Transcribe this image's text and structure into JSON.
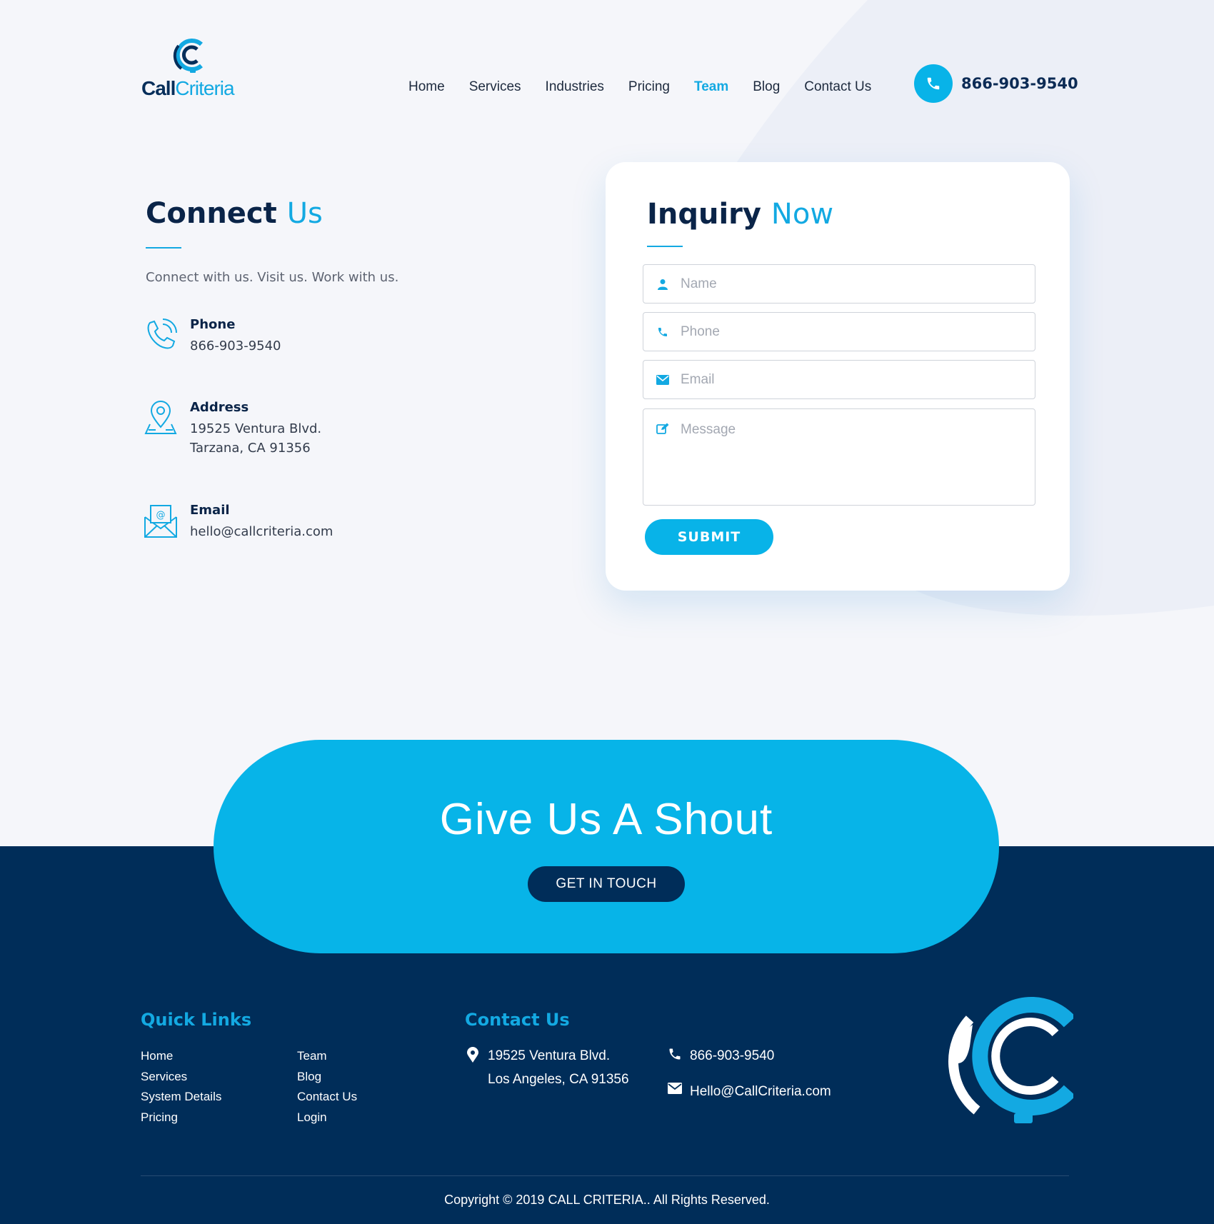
{
  "brand": {
    "name_bold": "Call",
    "name_light": "Criteria",
    "accent": "#13a9e2",
    "navy": "#002d59"
  },
  "nav": {
    "items": [
      {
        "label": "Home",
        "active": false
      },
      {
        "label": "Services",
        "active": false
      },
      {
        "label": "Industries",
        "active": false
      },
      {
        "label": "Pricing",
        "active": false
      },
      {
        "label": "Team",
        "active": true
      },
      {
        "label": "Blog",
        "active": false
      },
      {
        "label": "Contact Us",
        "active": false
      }
    ],
    "phone": "866-903-9540"
  },
  "connect": {
    "title_bold": "Connect",
    "title_light": "Us",
    "subtitle": "Connect with us. Visit us. Work with us.",
    "phone_label": "Phone",
    "phone_value": "866-903-9540",
    "address_label": "Address",
    "address_line1": "19525 Ventura Blvd.",
    "address_line2": "Tarzana, CA 91356",
    "email_label": "Email",
    "email_value": "hello@callcriteria.com"
  },
  "inquiry": {
    "title_bold": "Inquiry",
    "title_light": "Now",
    "name_placeholder": "Name",
    "phone_placeholder": "Phone",
    "email_placeholder": "Email",
    "message_placeholder": "Message",
    "submit_label": "SUBMIT"
  },
  "shout": {
    "title": "Give Us A Shout",
    "button_label": "GET IN TOUCH"
  },
  "footer": {
    "quick_links_heading": "Quick Links",
    "links_col1": [
      "Home",
      "Services",
      "System Details",
      "Pricing"
    ],
    "links_col2": [
      "Team",
      "Blog",
      "Contact Us",
      "Login"
    ],
    "contact_heading": "Contact Us",
    "address_line1": "19525 Ventura Blvd.",
    "address_line2": "Los Angeles, CA 91356",
    "phone": "866-903-9540",
    "email": "Hello@CallCriteria.com",
    "copyright": "Copyright © 2019 CALL CRITERIA.. All Rights Reserved."
  }
}
